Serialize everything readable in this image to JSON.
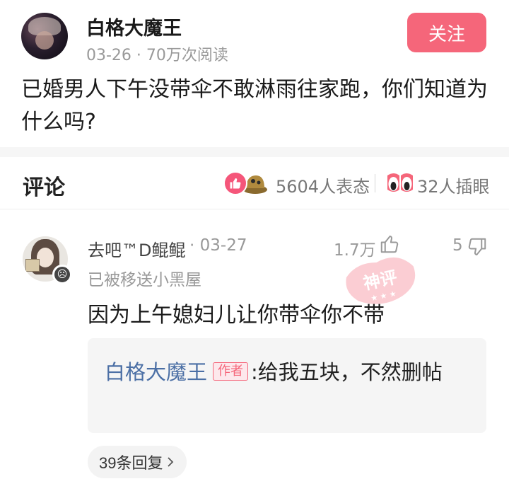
{
  "post": {
    "author": "白格大魔王",
    "meta": "03-26 · 70万次阅读",
    "follow_label": "关注",
    "text": "已婚男人下午没带伞不敢淋雨往家跑，你们知道为什么吗?"
  },
  "comments_bar": {
    "title": "评论",
    "reactions": "5604人表态",
    "eyes": "32人插眼"
  },
  "comment": {
    "user": "去吧™D鲲鲲",
    "date": "· 03-27",
    "likes": "1.7万",
    "dislikes": "5",
    "note": "已被移送小黑屋",
    "stamp": "神评",
    "text": "因为上午媳妇儿让你带伞你不带",
    "reply": {
      "name": "白格大魔王",
      "tag": "作者",
      "text": ":给我五块，不然删帖"
    },
    "more_replies": "39条回复"
  },
  "colors": {
    "accent": "#f5667a",
    "link": "#4b6fa5"
  }
}
